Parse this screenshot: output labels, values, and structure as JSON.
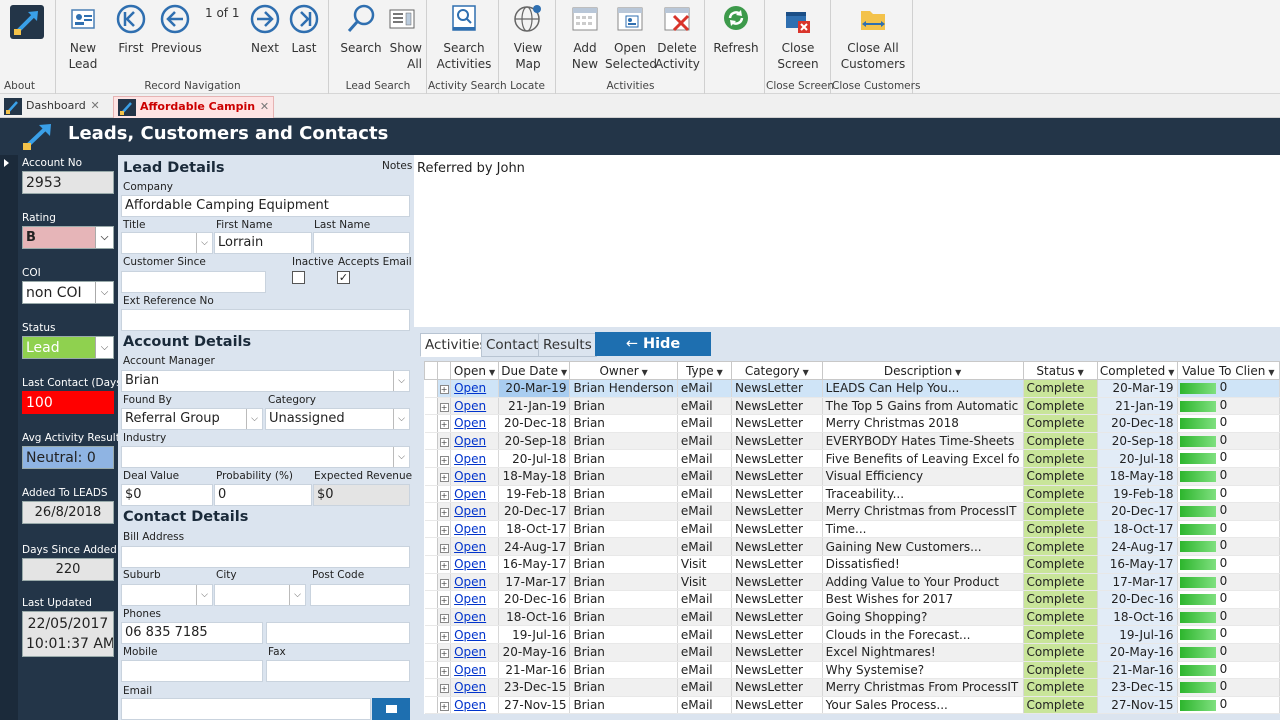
{
  "ribbon": {
    "groups": {
      "about": "About",
      "record_navigation": "Record Navigation",
      "lead_search": "Lead Search",
      "activity_search": "Activity Search",
      "locate": "Locate",
      "activities": "Activities",
      "close_screen": "Close Screen",
      "close_customers": "Close Customers"
    },
    "buttons": {
      "new_lead": "New\nLead",
      "first": "First",
      "previous": "Previous",
      "page_counter": "1 of 1",
      "next": "Next",
      "last": "Last",
      "search": "Search",
      "show_all": "Show\nAll",
      "search_activities": "Search\nActivities",
      "view_map": "View\nMap",
      "add_new": "Add\nNew",
      "open_selected": "Open\nSelected",
      "delete_activity": "Delete\nActivity",
      "refresh": "Refresh",
      "close_screen": "Close\nScreen",
      "close_all_customers": "Close All\nCustomers"
    }
  },
  "tabs": [
    {
      "label": "Dashboard",
      "close": "✕"
    },
    {
      "label": "Affordable Campin",
      "close": "✕"
    }
  ],
  "header": {
    "title": "Leads, Customers and Contacts"
  },
  "left": {
    "account_no_label": "Account No",
    "account_no": "2953",
    "rating_label": "Rating",
    "rating": "B",
    "coi_label": "COI",
    "coi": "non COI",
    "status_label": "Status",
    "status": "Lead",
    "last_contact_label": "Last Contact (Days)",
    "last_contact": "100",
    "avg_activity_label": "Avg Activity Result",
    "avg_activity": "Neutral: 0",
    "added_label": "Added To LEADS",
    "added": "26/8/2018",
    "days_since_label": "Days Since Added",
    "days_since": "220",
    "last_updated_label": "Last Updated",
    "last_updated_date": "22/05/2017",
    "last_updated_time": "10:01:37 AM"
  },
  "lead": {
    "heading": "Lead Details",
    "notes_label": "Notes",
    "company_label": "Company",
    "company": "Affordable Camping Equipment",
    "title_label": "Title",
    "title": "",
    "first_name_label": "First Name",
    "first_name": "Lorrain",
    "last_name_label": "Last Name",
    "last_name": "",
    "customer_since_label": "Customer Since",
    "customer_since": "",
    "inactive_label": "Inactive",
    "accepts_email_label": "Accepts Email",
    "ext_ref_label": "Ext Reference No",
    "ext_ref": ""
  },
  "account": {
    "heading": "Account Details",
    "manager_label": "Account Manager",
    "manager": "Brian",
    "found_by_label": "Found By",
    "found_by": "Referral Group",
    "category_label": "Category",
    "category": "Unassigned",
    "industry_label": "Industry",
    "industry": "",
    "deal_value_label": "Deal Value",
    "deal_value": "$0",
    "probability_label": "Probability (%)",
    "probability": "0",
    "expected_revenue_label": "Expected Revenue",
    "expected_revenue": "$0"
  },
  "contact": {
    "heading": "Contact Details",
    "bill_address_label": "Bill Address",
    "bill_address": "",
    "suburb_label": "Suburb",
    "city_label": "City",
    "post_code_label": "Post Code",
    "phones_label": "Phones",
    "phone1": "06 835 7185",
    "phone2": "",
    "mobile_label": "Mobile",
    "fax_label": "Fax",
    "email_label": "Email"
  },
  "notes": {
    "text": "Referred by John"
  },
  "grid": {
    "tabs": [
      "Activities",
      "Contact",
      "Results"
    ],
    "hide_details": "Hide Details",
    "columns": [
      "Open",
      "Due Date",
      "Owner",
      "Type",
      "Category",
      "Description",
      "Status",
      "Completed",
      "Value To Clien"
    ],
    "rows": [
      {
        "open": "Open",
        "due": "20-Mar-19",
        "owner": "Brian Henderson",
        "type": "eMail",
        "category": "NewsLetter",
        "desc": "LEADS Can Help You...",
        "status": "Complete",
        "completed": "20-Mar-19",
        "value": "0"
      },
      {
        "open": "Open",
        "due": "21-Jan-19",
        "owner": "Brian",
        "type": "eMail",
        "category": "NewsLetter",
        "desc": "The Top 5 Gains from Automatic",
        "status": "Complete",
        "completed": "21-Jan-19",
        "value": "0"
      },
      {
        "open": "Open",
        "due": "20-Dec-18",
        "owner": "Brian",
        "type": "eMail",
        "category": "NewsLetter",
        "desc": "Merry Christmas 2018",
        "status": "Complete",
        "completed": "20-Dec-18",
        "value": "0"
      },
      {
        "open": "Open",
        "due": "20-Sep-18",
        "owner": "Brian",
        "type": "eMail",
        "category": "NewsLetter",
        "desc": "EVERYBODY Hates Time-Sheets",
        "status": "Complete",
        "completed": "20-Sep-18",
        "value": "0"
      },
      {
        "open": "Open",
        "due": "20-Jul-18",
        "owner": "Brian",
        "type": "eMail",
        "category": "NewsLetter",
        "desc": "Five Benefits of Leaving Excel fo",
        "status": "Complete",
        "completed": "20-Jul-18",
        "value": "0"
      },
      {
        "open": "Open",
        "due": "18-May-18",
        "owner": "Brian",
        "type": "eMail",
        "category": "NewsLetter",
        "desc": "Visual Efficiency",
        "status": "Complete",
        "completed": "18-May-18",
        "value": "0"
      },
      {
        "open": "Open",
        "due": "19-Feb-18",
        "owner": "Brian",
        "type": "eMail",
        "category": "NewsLetter",
        "desc": "Traceability...",
        "status": "Complete",
        "completed": "19-Feb-18",
        "value": "0"
      },
      {
        "open": "Open",
        "due": "20-Dec-17",
        "owner": "Brian",
        "type": "eMail",
        "category": "NewsLetter",
        "desc": "Merry Christmas from ProcessIT",
        "status": "Complete",
        "completed": "20-Dec-17",
        "value": "0"
      },
      {
        "open": "Open",
        "due": "18-Oct-17",
        "owner": "Brian",
        "type": "eMail",
        "category": "NewsLetter",
        "desc": "Time...",
        "status": "Complete",
        "completed": "18-Oct-17",
        "value": "0"
      },
      {
        "open": "Open",
        "due": "24-Aug-17",
        "owner": "Brian",
        "type": "eMail",
        "category": "NewsLetter",
        "desc": "Gaining New Customers...",
        "status": "Complete",
        "completed": "24-Aug-17",
        "value": "0"
      },
      {
        "open": "Open",
        "due": "16-May-17",
        "owner": "Brian",
        "type": "Visit",
        "category": "NewsLetter",
        "desc": "Dissatisfied!",
        "status": "Complete",
        "completed": "16-May-17",
        "value": "0"
      },
      {
        "open": "Open",
        "due": "17-Mar-17",
        "owner": "Brian",
        "type": "Visit",
        "category": "NewsLetter",
        "desc": "Adding Value to Your Product",
        "status": "Complete",
        "completed": "17-Mar-17",
        "value": "0"
      },
      {
        "open": "Open",
        "due": "20-Dec-16",
        "owner": "Brian",
        "type": "eMail",
        "category": "NewsLetter",
        "desc": "Best Wishes for 2017",
        "status": "Complete",
        "completed": "20-Dec-16",
        "value": "0"
      },
      {
        "open": "Open",
        "due": "18-Oct-16",
        "owner": "Brian",
        "type": "eMail",
        "category": "NewsLetter",
        "desc": "Going Shopping?",
        "status": "Complete",
        "completed": "18-Oct-16",
        "value": "0"
      },
      {
        "open": "Open",
        "due": "19-Jul-16",
        "owner": "Brian",
        "type": "eMail",
        "category": "NewsLetter",
        "desc": "Clouds in the Forecast...",
        "status": "Complete",
        "completed": "19-Jul-16",
        "value": "0"
      },
      {
        "open": "Open",
        "due": "20-May-16",
        "owner": "Brian",
        "type": "eMail",
        "category": "NewsLetter",
        "desc": "Excel Nightmares!",
        "status": "Complete",
        "completed": "20-May-16",
        "value": "0"
      },
      {
        "open": "Open",
        "due": "21-Mar-16",
        "owner": "Brian",
        "type": "eMail",
        "category": "NewsLetter",
        "desc": "Why Systemise?",
        "status": "Complete",
        "completed": "21-Mar-16",
        "value": "0"
      },
      {
        "open": "Open",
        "due": "23-Dec-15",
        "owner": "Brian",
        "type": "eMail",
        "category": "NewsLetter",
        "desc": "Merry Christmas From ProcessIT",
        "status": "Complete",
        "completed": "23-Dec-15",
        "value": "0"
      },
      {
        "open": "Open",
        "due": "27-Nov-15",
        "owner": "Brian",
        "type": "eMail",
        "category": "NewsLetter",
        "desc": "Your Sales Process...",
        "status": "Complete",
        "completed": "27-Nov-15",
        "value": "0"
      }
    ]
  },
  "colors": {
    "navy": "#233548",
    "panel": "#dbe4ef",
    "accent_blue": "#1e6fb0",
    "rating_bg": "#e6b5b8",
    "status_bg": "#8fd14f",
    "last_contact_bg": "#ff0000",
    "avg_activity_bg": "#8fb4e3",
    "status_cell": "#c9e59a"
  }
}
